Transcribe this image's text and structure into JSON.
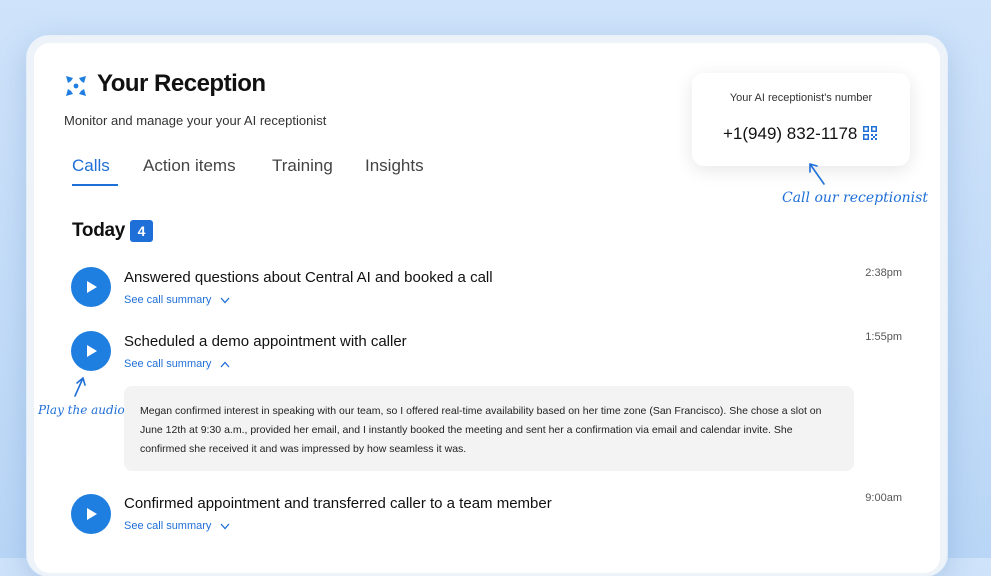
{
  "header": {
    "title": "Your Reception",
    "subtitle": "Monitor and manage your your AI receptionist"
  },
  "tabs": [
    {
      "label": "Calls",
      "active": true
    },
    {
      "label": "Action items",
      "active": false
    },
    {
      "label": "Training",
      "active": false
    },
    {
      "label": "Insights",
      "active": false
    }
  ],
  "receptionist": {
    "label": "Your AI receptionist's number",
    "number": "+1(949) 832-1178",
    "icon": "qr-code-icon"
  },
  "annotations": {
    "call": "Call our receptionist",
    "play": "Play the audio"
  },
  "section": {
    "title": "Today",
    "count": "4"
  },
  "calls": [
    {
      "title": "Answered questions about Central AI and booked a call",
      "time": "2:38pm",
      "summary_link": "See call summary",
      "expanded": false
    },
    {
      "title": "Scheduled a demo appointment with caller",
      "time": "1:55pm",
      "summary_link": "See call summary",
      "expanded": true,
      "summary": "Megan confirmed interest in speaking with our team, so I offered real-time availability based on her time zone (San Francisco). She chose a slot on June 12th at 9:30 a.m., provided her email, and I instantly booked the meeting and sent her a confirmation via email and calendar invite. She confirmed she received it and was impressed by how seamless it was."
    },
    {
      "title": "Confirmed appointment and transferred caller to a team member",
      "time": "9:00am",
      "summary_link": "See call summary",
      "expanded": false
    }
  ],
  "colors": {
    "accent": "#1f6fd8",
    "play_button": "#1f7fe0",
    "background": "#c4dcf8"
  }
}
